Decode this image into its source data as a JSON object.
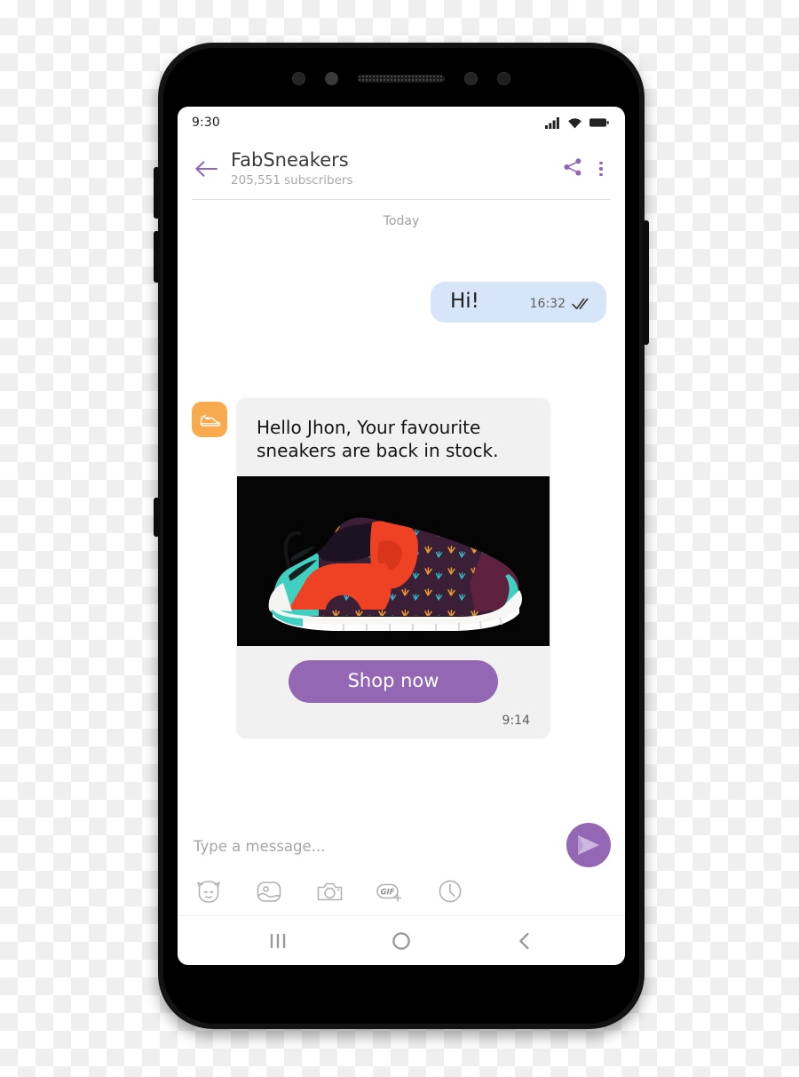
{
  "status_bar": {
    "time": "9:30",
    "icons": [
      "signal-icon",
      "wifi-icon",
      "battery-icon"
    ]
  },
  "header": {
    "back_icon": "arrow-left-icon",
    "channel_name": "FabSneakers",
    "subscriber_count": "205,551 subscribers",
    "share_icon": "share-icon",
    "overflow_icon": "more-vertical-icon",
    "accent_color": "#8d66b5"
  },
  "conversation": {
    "day_separator": "Today",
    "outgoing_message": {
      "text": "Hi!",
      "time": "16:32",
      "status_icon": "double-check-icon",
      "bubble_color": "#d6e5f8"
    },
    "incoming_message": {
      "avatar_icon": "sneaker-icon",
      "avatar_color": "#f7ab4e",
      "text": "Hello Jhon, Your favourite sneakers are back in stock.",
      "image_alt": "sneaker-product-photo",
      "cta_label": "Shop now",
      "cta_color": "#9367b4",
      "time": "9:14",
      "card_color": "#f1f1f1"
    }
  },
  "composer": {
    "placeholder": "Type a message...",
    "value": "",
    "send_icon": "send-icon",
    "send_color": "#9367b4",
    "attachments": [
      {
        "icon": "sticker-icon",
        "label": "Stickers"
      },
      {
        "icon": "gallery-icon",
        "label": "Gallery"
      },
      {
        "icon": "camera-icon",
        "label": "Camera"
      },
      {
        "icon": "gif-icon",
        "label": "GIF"
      },
      {
        "icon": "clock-icon",
        "label": "Scheduled"
      }
    ]
  },
  "nav_bar": {
    "buttons": [
      {
        "icon": "recents-icon",
        "label": "Recents"
      },
      {
        "icon": "home-icon",
        "label": "Home"
      },
      {
        "icon": "back-icon",
        "label": "Back"
      }
    ]
  }
}
